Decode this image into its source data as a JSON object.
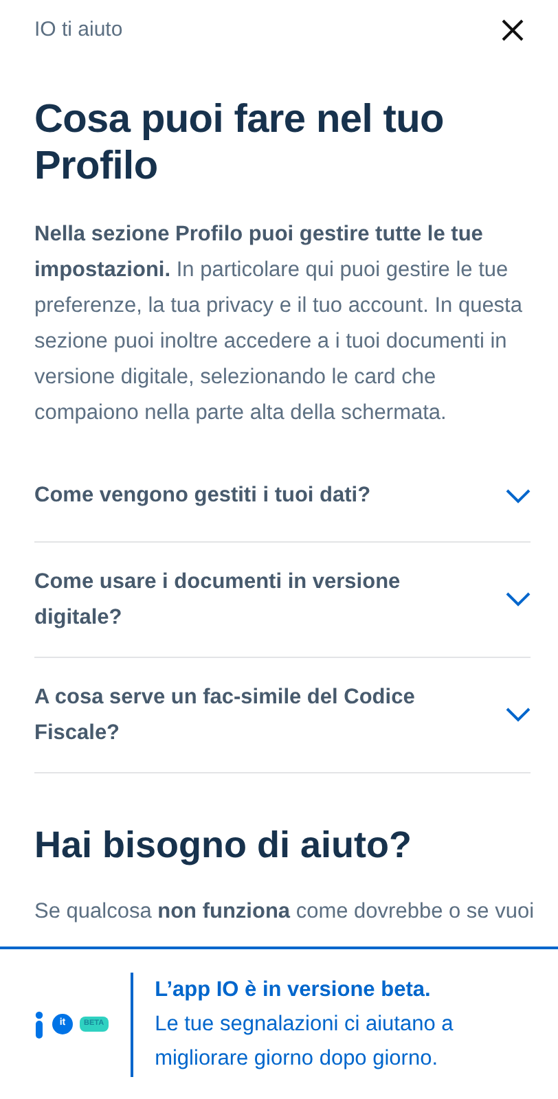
{
  "header": {
    "title": "IO ti aiuto"
  },
  "heading": "Cosa puoi fare nel tuo Profilo",
  "intro": "**Nella sezione Profilo puoi gestire tutte le tue impostazioni.** In particolare qui puoi gestire le tue preferenze, la tua privacy e il tuo account. In questa sezione puoi inoltre accedere a i tuoi documenti in versione digitale, selezionando le card che compaiono nella parte alta della schermata.",
  "faq": [
    {
      "question": "Come vengono gestiti i tuoi dati?",
      "expanded": false
    },
    {
      "question": "Come usare i documenti in versione digitale?",
      "expanded": false
    },
    {
      "question": "A cosa serve un fac-simile del Codice Fiscale?",
      "expanded": false
    }
  ],
  "help": {
    "title": "Hai bisogno di aiuto?",
    "text": "Se qualcosa **non funziona** come dovrebbe o se vuoi"
  },
  "beta_banner": {
    "logo_domain": "it",
    "badge": "BETA",
    "title": "L’app IO è in versione beta.",
    "text": "Le tue segnalazioni ci aiutano a migliorare giorno dopo giorno."
  }
}
